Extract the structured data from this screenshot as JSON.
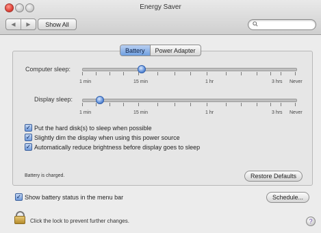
{
  "window": {
    "title": "Energy Saver"
  },
  "toolbar": {
    "back_glyph": "◀",
    "forward_glyph": "▶",
    "show_all_label": "Show All",
    "search_placeholder": "",
    "search_icon": "magnifying-glass"
  },
  "tabs": [
    {
      "label": "Battery",
      "selected": true
    },
    {
      "label": "Power Adapter",
      "selected": false
    }
  ],
  "sliders": {
    "computer_sleep": {
      "label": "Computer sleep:",
      "value": "15 min"
    },
    "display_sleep": {
      "label": "Display sleep:",
      "value": "2 min"
    },
    "tick_labels": [
      "1 min",
      "15 min",
      "1 hr",
      "3 hrs",
      "Never"
    ]
  },
  "checkboxes": [
    {
      "label": "Put the hard disk(s) to sleep when possible",
      "checked": true
    },
    {
      "label": "Slightly dim the display when using this power source",
      "checked": true
    },
    {
      "label": "Automatically reduce brightness before display goes to sleep",
      "checked": true
    }
  ],
  "status": {
    "text": "Battery is charged."
  },
  "buttons": {
    "restore_defaults": "Restore Defaults",
    "schedule": "Schedule..."
  },
  "menubar_status": {
    "label": "Show battery status in the menu bar",
    "checked": true
  },
  "lock": {
    "text": "Click the lock to prevent further changes."
  },
  "help": {
    "glyph": "?"
  },
  "colors": {
    "accent": "#6f9fe0",
    "close_button": "#e0443a"
  }
}
